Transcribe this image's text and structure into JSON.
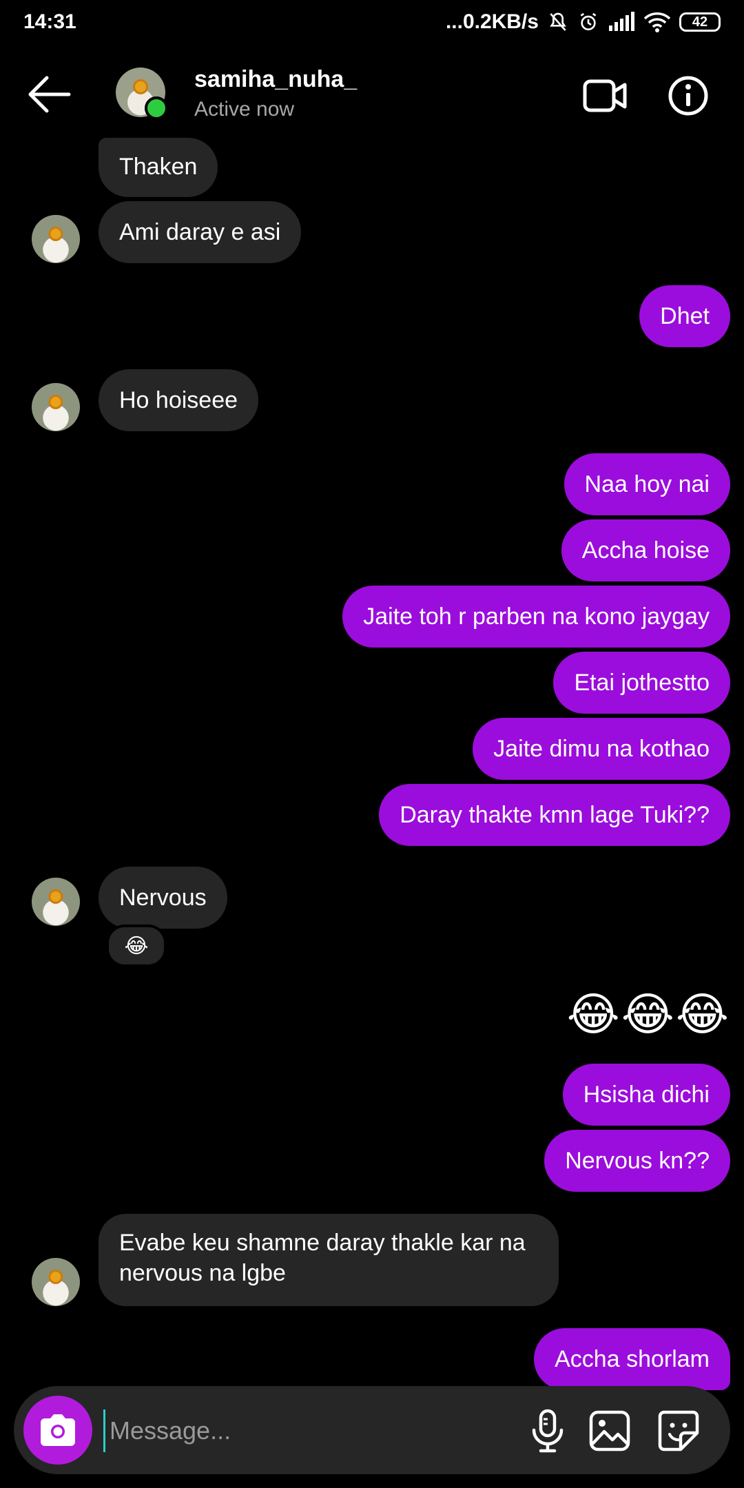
{
  "status_bar": {
    "time": "14:31",
    "network_speed": "...0.2KB/s",
    "battery": "42"
  },
  "header": {
    "username": "samiha_nuha_",
    "status": "Active now",
    "back_icon": "arrow-left-icon",
    "video_icon": "video-camera-icon",
    "info_icon": "info-icon"
  },
  "colors": {
    "outgoing_bubble": "#9b0ddc",
    "incoming_bubble": "#262626",
    "background": "#000000",
    "online_dot": "#2ecc40",
    "camera_button": "#b11bdc"
  },
  "messages": [
    {
      "from": "them",
      "text": "Thaken"
    },
    {
      "from": "them",
      "text": "Ami daray e asi"
    },
    {
      "from": "me",
      "text": "Dhet"
    },
    {
      "from": "them",
      "text": "Ho hoiseee"
    },
    {
      "from": "me",
      "text": "Naa hoy nai"
    },
    {
      "from": "me",
      "text": "Accha hoise"
    },
    {
      "from": "me",
      "text": "Jaite toh r parben na kono jaygay"
    },
    {
      "from": "me",
      "text": "Etai jothestto"
    },
    {
      "from": "me",
      "text": "Jaite dimu na kothao"
    },
    {
      "from": "me",
      "text": "Daray thakte kmn lage Tuki??"
    },
    {
      "from": "them",
      "text": "Nervous",
      "reaction": "😂"
    },
    {
      "from": "me",
      "text": "😂😂😂"
    },
    {
      "from": "me",
      "text": "Hsisha dichi"
    },
    {
      "from": "me",
      "text": "Nervous kn??"
    },
    {
      "from": "them",
      "text": "Evabe keu shamne daray thakle kar na nervous na lgbe"
    },
    {
      "from": "me",
      "text": "Accha shorlam"
    }
  ],
  "composer": {
    "placeholder": "Message...",
    "camera_icon": "camera-icon",
    "mic_icon": "microphone-icon",
    "gallery_icon": "image-icon",
    "sticker_icon": "sticker-icon"
  }
}
